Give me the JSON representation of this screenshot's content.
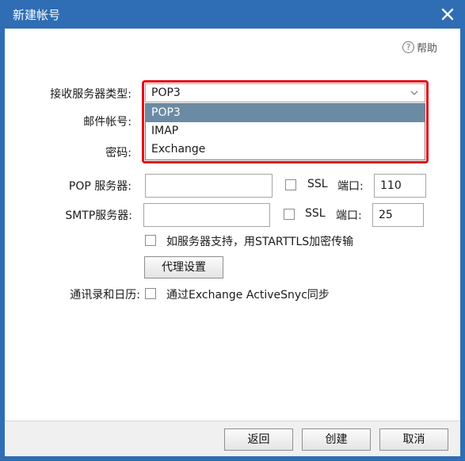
{
  "window": {
    "title": "新建帐号"
  },
  "help": {
    "label": "帮助"
  },
  "form": {
    "type_label": "接收服务器类型:",
    "type_value": "POP3",
    "type_options": [
      "POP3",
      "IMAP",
      "Exchange"
    ],
    "account_label": "邮件帐号:",
    "password_label": "密码:",
    "pop_label": "POP 服务器:",
    "pop_value": "",
    "pop_ssl": "SSL",
    "pop_port_label": "端口:",
    "pop_port": "110",
    "smtp_label": "SMTP服务器:",
    "smtp_value": "",
    "smtp_ssl": "SSL",
    "smtp_port_label": "端口:",
    "smtp_port": "25",
    "starttls_label": "如服务器支持，用STARTTLS加密传输",
    "proxy_button": "代理设置",
    "contacts_label": "通讯录和日历:",
    "activesync_label": "通过Exchange ActiveSnyc同步"
  },
  "footer": {
    "back": "返回",
    "create": "创建",
    "cancel": "取消"
  },
  "colors": {
    "titlebar": "#2f6db5",
    "selected_option": "#6b8aa4",
    "highlight": "#e0101a"
  },
  "icons": {
    "close": "close-icon",
    "help": "help-circle-icon",
    "dropdown": "chevron-down-icon"
  }
}
